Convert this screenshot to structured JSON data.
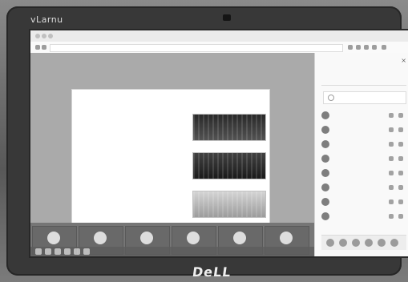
{
  "monitor": {
    "top_brand": "vLarnu",
    "bottom_brand": "DeLL"
  },
  "browser": {
    "tab_text": "",
    "url_text": ""
  },
  "meeting": {
    "title_text": ""
  },
  "slide": {
    "title": "",
    "bullets": [
      "",
      "",
      "",
      "",
      "",
      "",
      "",
      ""
    ]
  },
  "panel": {
    "header": "",
    "tabs": [
      "",
      "",
      ""
    ],
    "search_placeholder": "",
    "people": [
      {
        "name": ""
      },
      {
        "name": ""
      },
      {
        "name": ""
      },
      {
        "name": ""
      },
      {
        "name": ""
      },
      {
        "name": ""
      },
      {
        "name": ""
      },
      {
        "name": ""
      }
    ]
  },
  "strip": {
    "tiles": [
      {
        "name": ""
      },
      {
        "name": ""
      },
      {
        "name": ""
      },
      {
        "name": ""
      },
      {
        "name": ""
      },
      {
        "name": ""
      }
    ]
  }
}
